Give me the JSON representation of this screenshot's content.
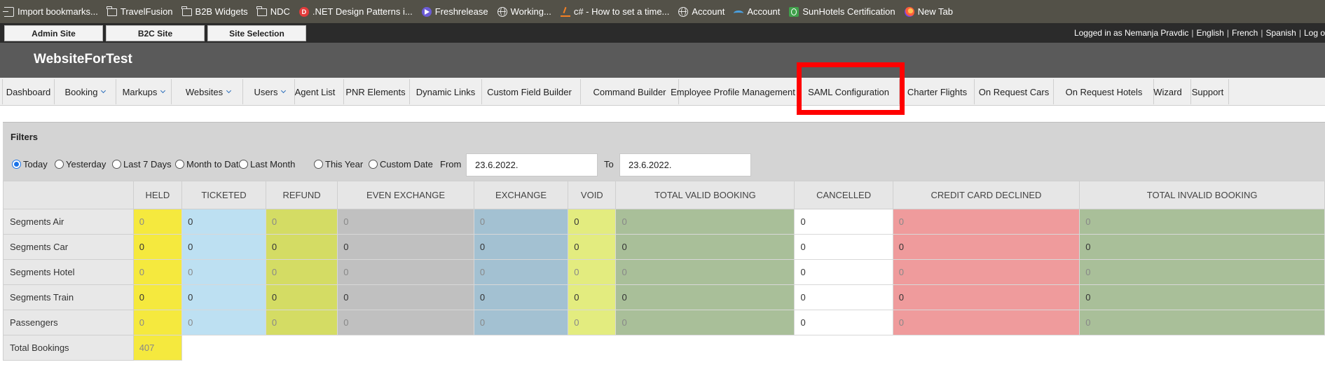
{
  "bookmarks": [
    {
      "label": "Import bookmarks...",
      "icon": "import-icon"
    },
    {
      "label": "TravelFusion",
      "icon": "folder-icon"
    },
    {
      "label": "B2B Widgets",
      "icon": "folder-icon"
    },
    {
      "label": "NDC",
      "icon": "folder-icon"
    },
    {
      "label": ".NET Design Patterns i...",
      "icon": "dotnet-icon",
      "glyph": "D"
    },
    {
      "label": "Freshrelease",
      "icon": "freshrelease-icon"
    },
    {
      "label": "Working...",
      "icon": "globe-icon"
    },
    {
      "label": "c# - How to set a time...",
      "icon": "stackoverflow-icon"
    },
    {
      "label": "Account",
      "icon": "globe-icon"
    },
    {
      "label": "Account",
      "icon": "wave-icon"
    },
    {
      "label": "SunHotels Certification",
      "icon": "sunhotels-icon"
    },
    {
      "label": "New Tab",
      "icon": "firefox-icon"
    }
  ],
  "top_tabs": [
    "Admin Site",
    "B2C Site",
    "Site Selection"
  ],
  "user_bar": {
    "logged_in": "Logged in as Nemanja Pravdic",
    "sep": "|",
    "languages": [
      "English",
      "French",
      "Spanish"
    ],
    "logout": "Log o"
  },
  "site_title": "WebsiteForTest",
  "nav": [
    {
      "label": "Dashboard",
      "dropdown": false
    },
    {
      "label": "Booking",
      "dropdown": true
    },
    {
      "label": "Markups",
      "dropdown": true
    },
    {
      "label": "Websites",
      "dropdown": true
    },
    {
      "label": "Users",
      "dropdown": true
    },
    {
      "label": "Agent List",
      "dropdown": false
    },
    {
      "label": "PNR Elements",
      "dropdown": false
    },
    {
      "label": "Dynamic Links",
      "dropdown": false
    },
    {
      "label": "Custom Field Builder",
      "dropdown": false
    },
    {
      "label": "Command Builder",
      "dropdown": false
    },
    {
      "label": "Employee Profile Management",
      "dropdown": false
    },
    {
      "label": "SAML Configuration",
      "dropdown": false
    },
    {
      "label": "Charter Flights",
      "dropdown": false
    },
    {
      "label": "On Request Cars",
      "dropdown": false
    },
    {
      "label": "On Request Hotels",
      "dropdown": false
    },
    {
      "label": "Wizard",
      "dropdown": false
    },
    {
      "label": "Support",
      "dropdown": false
    }
  ],
  "filters": {
    "title": "Filters",
    "ranges": [
      "Today",
      "Yesterday",
      "Last 7 Days",
      "Month to Date",
      "Last Month",
      "This Year",
      "Custom Date"
    ],
    "selected": "Today",
    "from_label": "From",
    "to_label": "To",
    "from_value": "23.6.2022.",
    "to_value": "23.6.2022."
  },
  "table": {
    "columns": [
      "HELD",
      "TICKETED",
      "REFUND",
      "EVEN EXCHANGE",
      "EXCHANGE",
      "VOID",
      "TOTAL VALID BOOKING",
      "CANCELLED",
      "CREDIT CARD DECLINED",
      "TOTAL INVALID BOOKING"
    ],
    "column_colors": [
      "#f5e93e",
      "#bde0f2",
      "#d4dc64",
      "#c0c0c0",
      "#a3c1d2",
      "#e3ec7f",
      "#a9bf99",
      "#ffffff",
      "#ef9b9c",
      "#a9bf99"
    ],
    "rows": [
      {
        "label": "Segments Air",
        "values": [
          "0",
          "0",
          "0",
          "0",
          "0",
          "0",
          "0",
          "0",
          "0",
          "0"
        ]
      },
      {
        "label": "Segments Car",
        "values": [
          "0",
          "0",
          "0",
          "0",
          "0",
          "0",
          "0",
          "0",
          "0",
          "0"
        ]
      },
      {
        "label": "Segments Hotel",
        "values": [
          "0",
          "0",
          "0",
          "0",
          "0",
          "0",
          "0",
          "0",
          "0",
          "0"
        ]
      },
      {
        "label": "Segments Train",
        "values": [
          "0",
          "0",
          "0",
          "0",
          "0",
          "0",
          "0",
          "0",
          "0",
          "0"
        ]
      },
      {
        "label": "Passengers",
        "values": [
          "0",
          "0",
          "0",
          "0",
          "0",
          "0",
          "0",
          "0",
          "0",
          "0"
        ]
      }
    ],
    "total_label": "Total Bookings",
    "total_value": "407"
  },
  "colors": {
    "highlight": "#ff0000",
    "radio_selected": "#1a73e8",
    "chevron": "#2a6ebb"
  }
}
